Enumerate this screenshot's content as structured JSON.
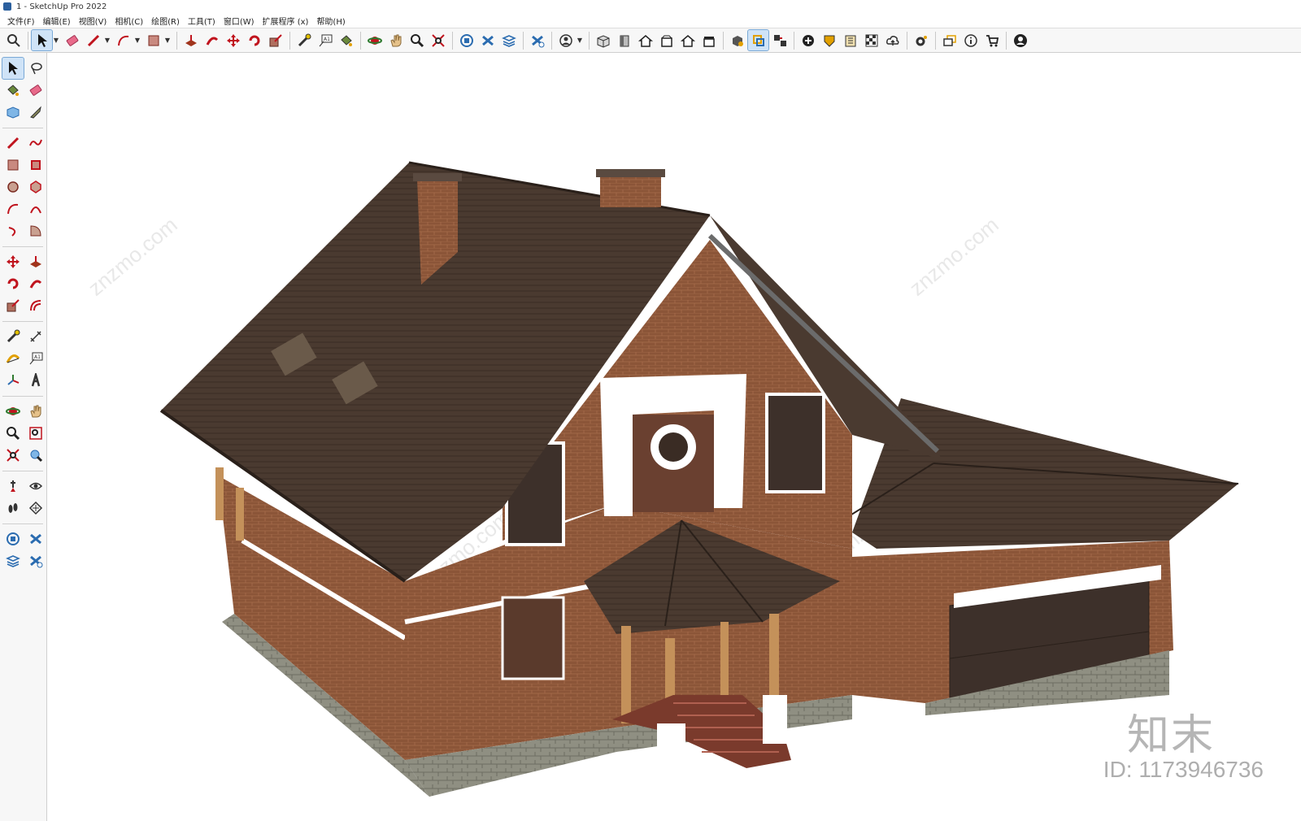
{
  "window": {
    "title": "1 - SketchUp Pro 2022"
  },
  "menu": [
    "文件(F)",
    "编辑(E)",
    "视图(V)",
    "相机(C)",
    "绘图(R)",
    "工具(T)",
    "窗口(W)",
    "扩展程序 (x)",
    "帮助(H)"
  ],
  "watermark": {
    "brand": "知末",
    "id": "ID: 1173946736",
    "diagonal": "znzmo.com"
  },
  "colors": {
    "roof": "#4a3a30",
    "brick": "#8b5538",
    "trim": "#ffffff",
    "stone": "#8f8f82",
    "accent": "#2b6cb0"
  }
}
